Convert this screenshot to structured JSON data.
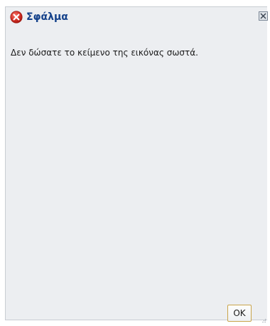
{
  "dialog": {
    "title": "Σφάλμα",
    "icon": "error-icon",
    "message": "Δεν δώσατε το κείμενο της εικόνας σωστά.",
    "ok_label": "OK",
    "close_icon": "close-icon"
  },
  "colors": {
    "background": "#eceef1",
    "title": "#15428b",
    "error_red": "#d9342b",
    "ok_border": "#c9a44a"
  }
}
